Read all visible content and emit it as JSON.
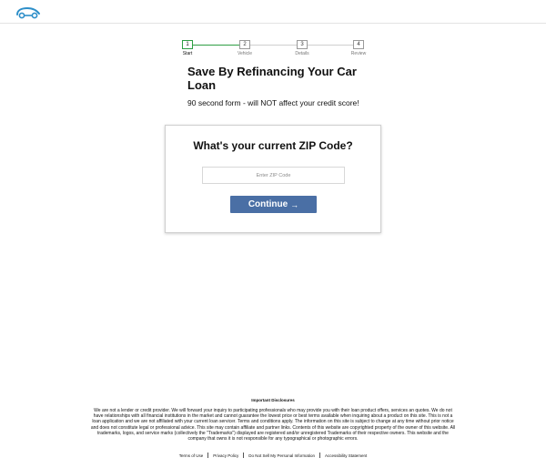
{
  "header": {
    "logo_icon": "car-key-logo-icon",
    "accent_color": "#2e8fc9"
  },
  "stepper": {
    "steps": [
      {
        "number": "1",
        "label": "Start"
      },
      {
        "number": "2",
        "label": "Vehicle"
      },
      {
        "number": "3",
        "label": "Details"
      },
      {
        "number": "4",
        "label": "Review"
      }
    ],
    "current_step": 1,
    "active_color": "#2e9e44"
  },
  "hero": {
    "title": "Save By Refinancing Your Car Loan",
    "subtitle": "90 second form - will NOT affect your credit score!"
  },
  "form": {
    "question": "What's your current ZIP Code?",
    "zip": {
      "value": "",
      "placeholder": "Enter ZIP Code"
    },
    "continue_label": "Continue",
    "continue_icon": "arrow-right-icon",
    "button_color": "#4a6fa5"
  },
  "disclosures": {
    "title": "Important Disclosures",
    "text": "We are not a lender or credit provider. We will forward your inquiry to participating professionals who may provide you with their loan product offers, services an quotes. We do not have relationships with all financial institutions in the market and cannot guarantee the lowest price or best terms available when inquiring about a product on this site. This is not a loan application and we are not affiliated with your current loan servicer. Terms and conditions apply. The information on this site is subject to change at any time without prior notice and does not constitute legal or professional advice. This site may contain affiliate and partner links. Contents of this website are copyrighted property of the owner of this website. All trademarks, logos, and service marks (collectively the \"Trademarks\") displayed are registered and/or unregistered Trademarks of their respective owners. This website and the company that owns it is not responsible for any typographical or photographic errors."
  },
  "footer": {
    "links": [
      "Terms of Use",
      "Privacy Policy",
      "Do Not Sell My Personal Information",
      "Accessibility Statement"
    ]
  }
}
